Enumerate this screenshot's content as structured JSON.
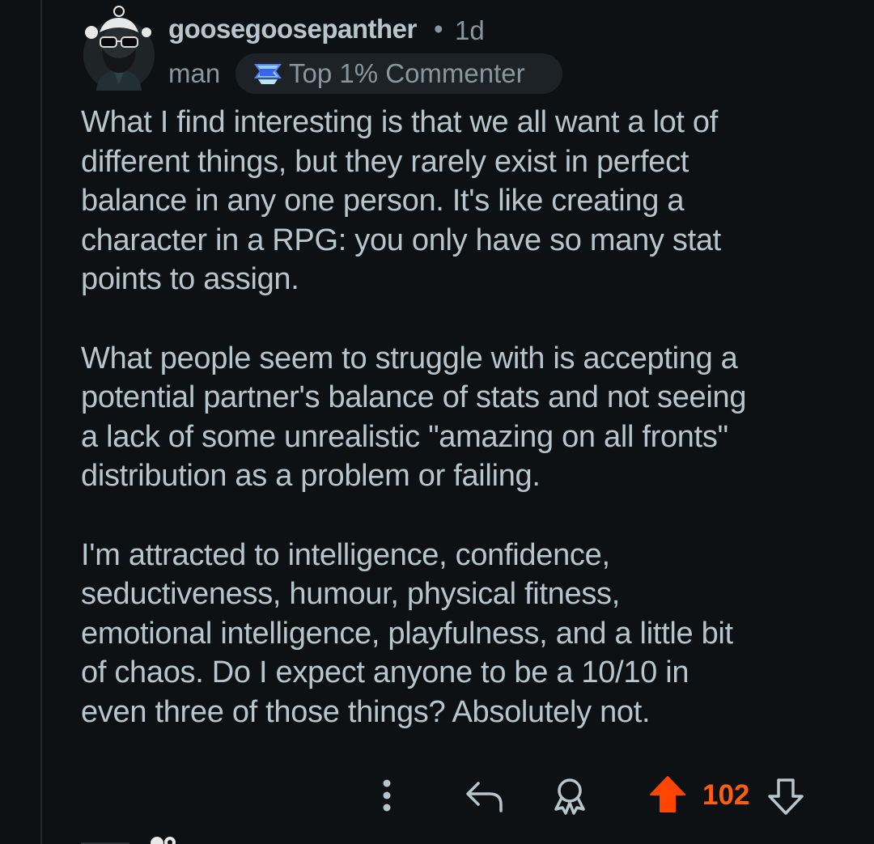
{
  "comment": {
    "author": "goosegoosepanther",
    "separator": "•",
    "age": "1d",
    "flair": "man",
    "badge_label": "Top 1% Commenter",
    "paragraphs": [
      "What I find interesting is that we all want a lot of\ndifferent things, but they rarely exist in perfect\nbalance in any one person. It's like creating a\ncharacter in a RPG: you only have so many stat\npoints to assign.",
      "What people seem to struggle with is accepting a\npotential partner's balance of stats and not seeing\na lack of some unrealistic \"amazing on all fronts\"\ndistribution as a problem or failing.",
      "I'm attracted to intelligence, confidence,\nseductiveness, humour, physical fitness,\nemotional intelligence, playfulness, and a little bit\nof chaos. Do I expect anyone to be a 10/10 in\neven three of those things? Absolutely not."
    ],
    "score": "102"
  },
  "actions": {
    "icons": [
      "more-options-icon",
      "reply-icon",
      "award-icon",
      "upvote-icon",
      "downvote-icon"
    ]
  },
  "colors": {
    "background": "#0e1113",
    "text": "#b8c5cd",
    "muted": "#8a969e",
    "upvote": "#ff4500",
    "score": "#ff5d12",
    "badge_bg": "#1c2226"
  }
}
